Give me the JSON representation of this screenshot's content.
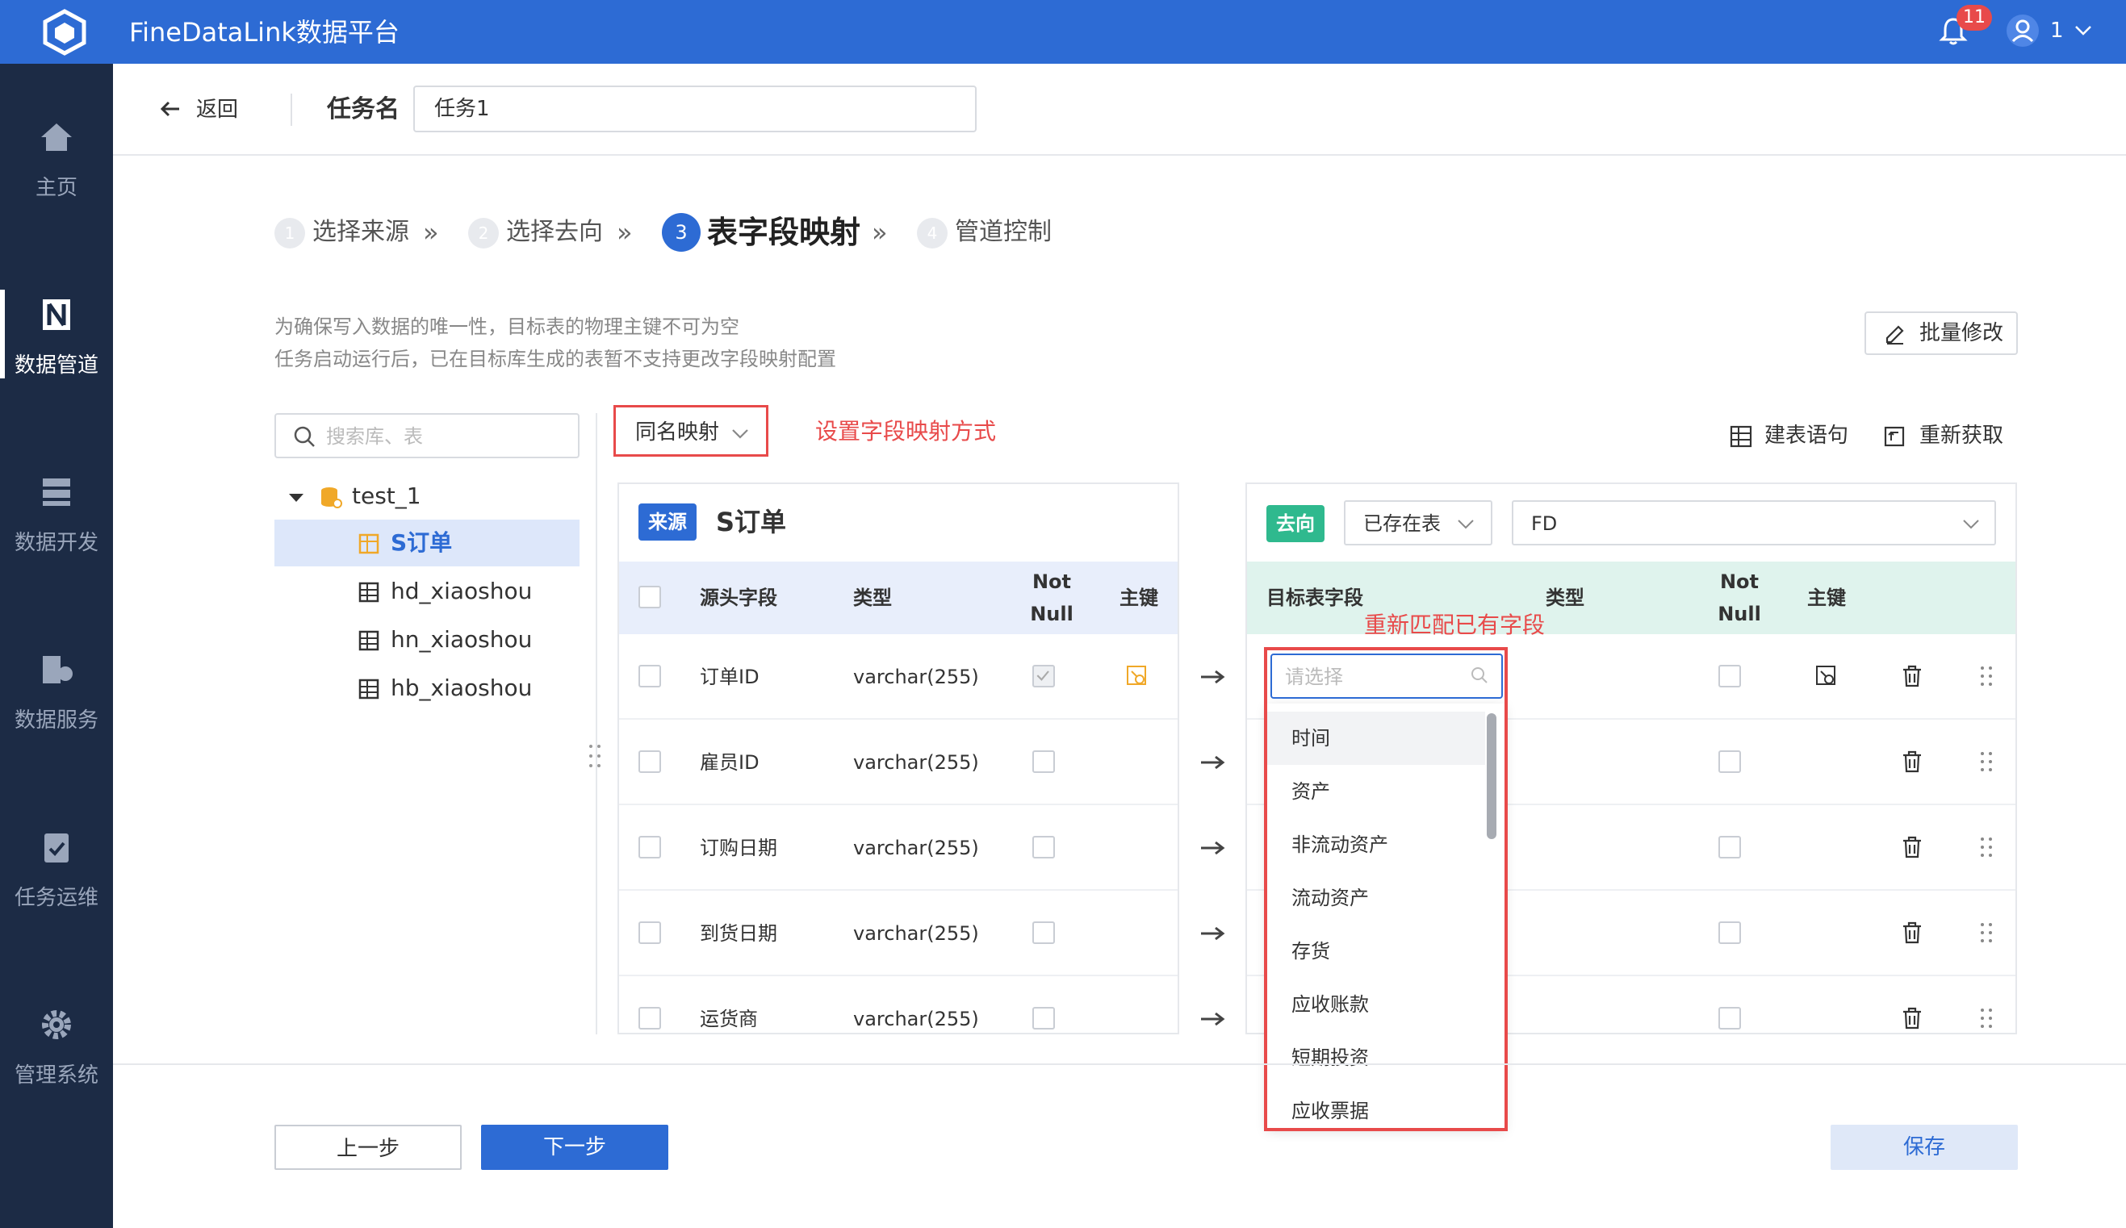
{
  "app": {
    "title": "FineDataLink数据平台",
    "notification_count": "11",
    "user_name": "1"
  },
  "sidebar": {
    "items": [
      {
        "label": "主页",
        "icon": "home-icon"
      },
      {
        "label": "数据管道",
        "icon": "pipeline-icon",
        "active": true
      },
      {
        "label": "数据开发",
        "icon": "dev-icon"
      },
      {
        "label": "数据服务",
        "icon": "service-icon"
      },
      {
        "label": "任务运维",
        "icon": "task-ops-icon"
      },
      {
        "label": "管理系统",
        "icon": "gear-icon"
      }
    ]
  },
  "header": {
    "back_label": "返回",
    "task_name_label": "任务名",
    "task_name_value": "任务1"
  },
  "steps": [
    {
      "num": "1",
      "label": "选择来源"
    },
    {
      "num": "2",
      "label": "选择去向"
    },
    {
      "num": "3",
      "label": "表字段映射",
      "active": true
    },
    {
      "num": "4",
      "label": "管道控制"
    }
  ],
  "notes": [
    "为确保写入数据的唯一性，目标表的物理主键不可为空",
    "任务启动运行后，已在目标库生成的表暂不支持更改字段映射配置"
  ],
  "batch_edit_label": "批量修改",
  "search": {
    "placeholder": "搜索库、表"
  },
  "tree": {
    "db": "test_1",
    "tables": [
      "S订单",
      "hd_xiaoshou",
      "hn_xiaoshou",
      "hb_xiaoshou"
    ],
    "selected": "S订单"
  },
  "mapping": {
    "mode": "同名映射",
    "annotation": "设置字段映射方式",
    "create_sql_label": "建表语句",
    "refetch_label": "重新获取"
  },
  "source": {
    "tag": "来源",
    "table": "S订单",
    "headers": {
      "field": "源头字段",
      "type": "类型",
      "not_null_1": "Not",
      "not_null_2": "Null",
      "pk": "主键"
    },
    "rows": [
      {
        "field": "订单ID",
        "type": "varchar(255)",
        "not_null": true,
        "pk": true
      },
      {
        "field": "雇员ID",
        "type": "varchar(255)",
        "not_null": false,
        "pk": false
      },
      {
        "field": "订购日期",
        "type": "varchar(255)",
        "not_null": false,
        "pk": false
      },
      {
        "field": "到货日期",
        "type": "varchar(255)",
        "not_null": false,
        "pk": false
      },
      {
        "field": "运货商",
        "type": "varchar(255)",
        "not_null": false,
        "pk": false
      }
    ]
  },
  "target": {
    "tag": "去向",
    "table_mode": "已存在表",
    "table_name": "FD",
    "headers": {
      "field": "目标表字段",
      "type": "类型",
      "not_null_1": "Not",
      "not_null_2": "Null",
      "pk": "主键"
    },
    "annotation": "重新匹配已有字段",
    "dropdown": {
      "placeholder": "请选择",
      "options": [
        "时间",
        "资产",
        "非流动资产",
        "流动资产",
        "存货",
        "应收账款",
        "短期投资",
        "应收票据"
      ]
    }
  },
  "footer": {
    "prev_label": "上一步",
    "next_label": "下一步",
    "save_label": "保存"
  },
  "colors": {
    "primary": "#2d6bd4",
    "sidebar": "#1c2b45",
    "annotation": "#e84a4a",
    "target_tag": "#2fb98e"
  }
}
